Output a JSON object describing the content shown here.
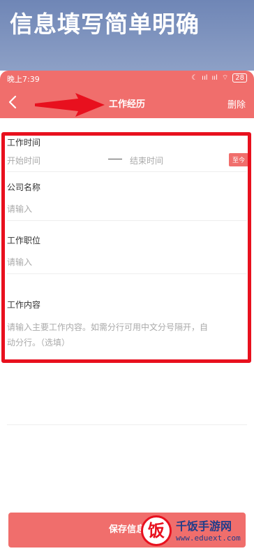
{
  "banner": {
    "text": "信息填写简单明确"
  },
  "status_bar": {
    "time": "晚上7:39",
    "signal1": "ııl",
    "signal2": "ııl",
    "battery": "28"
  },
  "nav": {
    "title": "工作经历",
    "delete_label": "删除"
  },
  "form": {
    "work_time": {
      "label": "工作时间",
      "start_placeholder": "开始时间",
      "end_placeholder": "结束时间",
      "present_label": "至今"
    },
    "company": {
      "label": "公司名称",
      "placeholder": "请输入"
    },
    "position": {
      "label": "工作职位",
      "placeholder": "请输入"
    },
    "content": {
      "label": "工作内容",
      "placeholder_line1": "请输入主要工作内容。如需分行可用中文分号隔开，自",
      "placeholder_line2": "动分行。（选填）"
    }
  },
  "save_button": {
    "label": "保存信息"
  },
  "watermark": {
    "logo_char": "饭",
    "title": "千饭手游网",
    "url": "www.eduext.com"
  },
  "colors": {
    "accent": "#f06e6c",
    "annotation_red": "#e8101e",
    "banner_blue": "#6f86b6"
  }
}
